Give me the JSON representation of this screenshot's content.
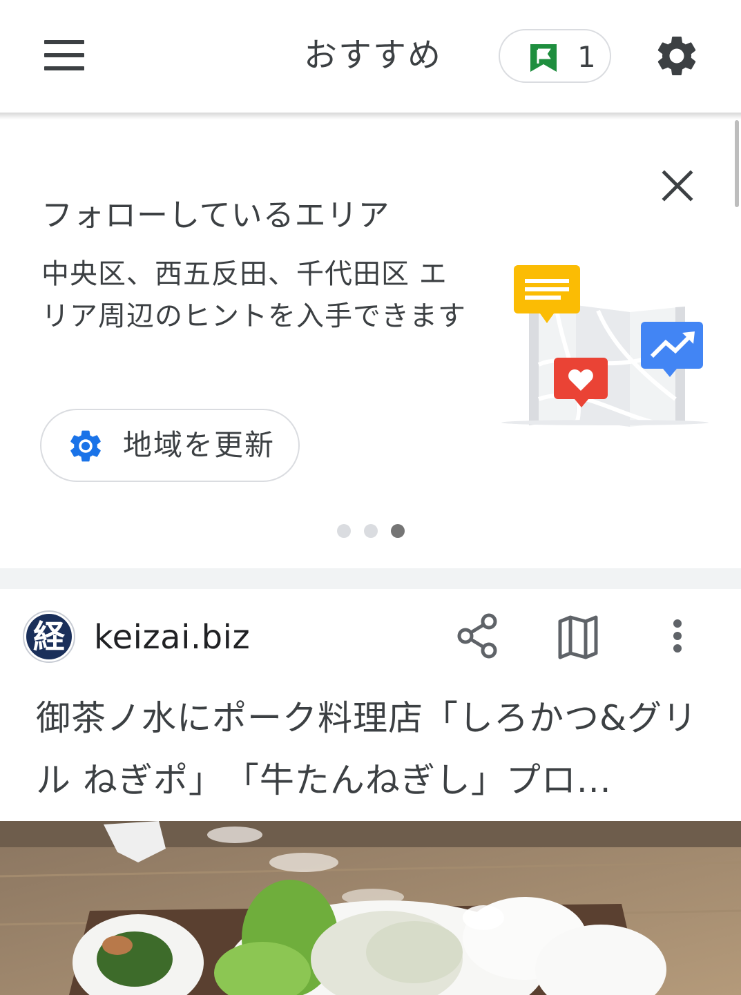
{
  "header": {
    "title": "おすすめ",
    "flag_count": "1",
    "menu_icon": "hamburger-menu-icon",
    "flag_icon": "green-flag-icon",
    "settings_icon": "gear-icon"
  },
  "promo": {
    "heading": "フォローしているエリア",
    "body": "中央区、西五反田、千代田区 エリア周辺のヒントを入手できます",
    "button_label": "地域を更新",
    "button_icon": "gear-icon",
    "close_icon": "close-icon",
    "pager": {
      "count": 3,
      "active_index": 2
    }
  },
  "article": {
    "publisher_logo_text": "経",
    "publisher": "keizai.biz",
    "title": "御茶ノ水にポーク料理店「しろかつ&グリル ねぎポ」　「牛たんねぎし」プロ...",
    "actions": [
      "share-icon",
      "map-icon",
      "more-vert-icon"
    ]
  },
  "colors": {
    "flag_green": "#1e8e3e",
    "accent_blue": "#1a73e8",
    "chip_yellow": "#fbbc04",
    "chip_red": "#ea4335",
    "chip_blue": "#4285f4",
    "logo_navy": "#1a2f5a"
  }
}
